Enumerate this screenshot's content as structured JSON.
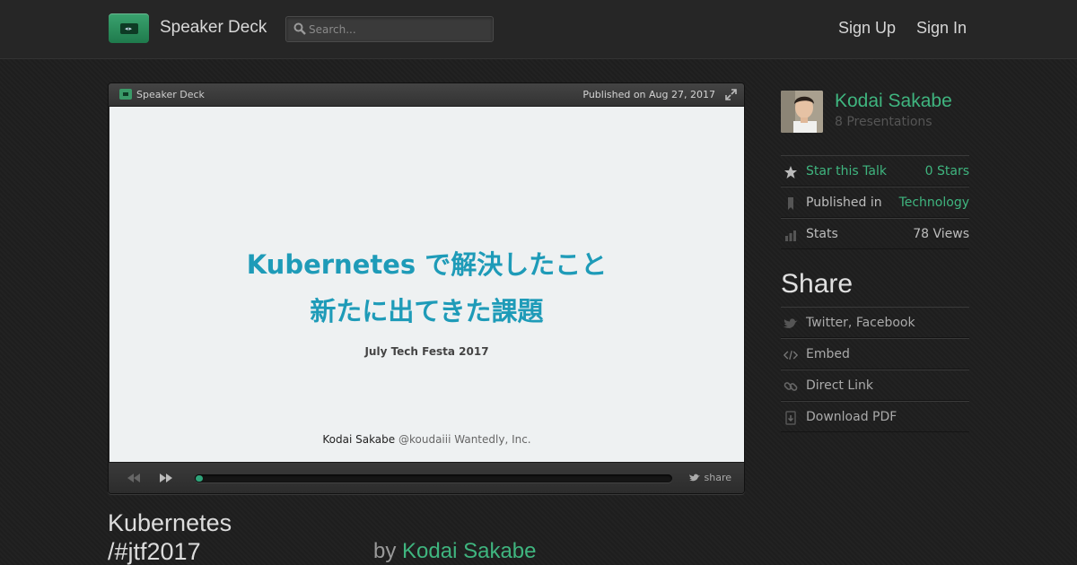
{
  "header": {
    "brand": "Speaker Deck",
    "search_placeholder": "Search...",
    "sign_up": "Sign Up",
    "sign_in": "Sign In"
  },
  "player": {
    "brand": "Speaker Deck",
    "published": "Published on Aug 27, 2017",
    "slide": {
      "title_line1": "Kubernetes で解決したこと",
      "title_line2": "新たに出てきた課題",
      "event": "July Tech Festa 2017",
      "author_name": "Kodai Sakabe",
      "author_rest": "@koudaiii Wantedly, Inc."
    },
    "progress_fraction": 0.015,
    "share_label": "share"
  },
  "talk": {
    "title_line1": "Kubernetes",
    "title_line2": "/#jtf2017",
    "by_label": "by",
    "author": "Kodai Sakabe"
  },
  "sidebar": {
    "author_name": "Kodai Sakabe",
    "presentations": "8 Presentations",
    "stats": [
      {
        "icon": "star-icon",
        "label": "Star this Talk",
        "value": "0 Stars"
      },
      {
        "icon": "bookmark-icon",
        "label": "Published in",
        "value": "Technology"
      },
      {
        "icon": "bar-chart-icon",
        "label": "Stats",
        "value": "78 Views"
      }
    ],
    "share_heading": "Share",
    "share_items": [
      {
        "icon": "bird-icon",
        "label": "Twitter, Facebook"
      },
      {
        "icon": "code-icon",
        "label": "Embed"
      },
      {
        "icon": "link-icon",
        "label": "Direct Link"
      },
      {
        "icon": "download-icon",
        "label": "Download PDF"
      }
    ]
  },
  "colors": {
    "accent_green": "#3fb57f",
    "slide_title": "#1e9bb8",
    "background": "#1f1f1f"
  }
}
